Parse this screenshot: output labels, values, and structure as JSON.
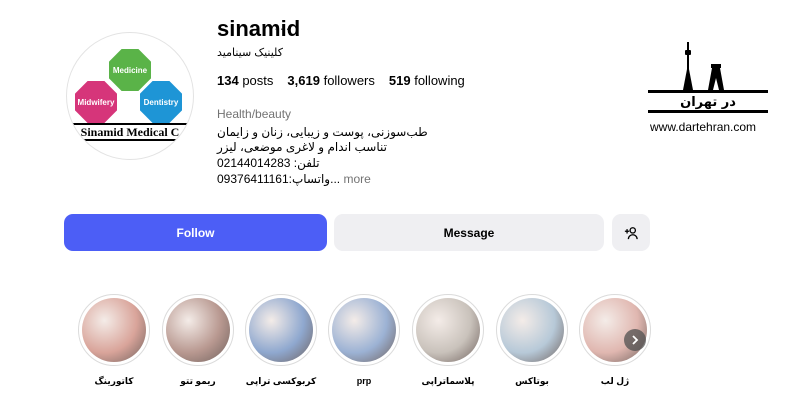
{
  "profile": {
    "username": "sinamid",
    "more_dots": "···",
    "full_name": "کلینیک سینامید",
    "category": "Health/beauty",
    "bio_lines": [
      "طب‌سوزنی، پوست و زیبایی، زنان و زایمان",
      "تناسب اندام و لاغری موضعی، لیزر",
      "تلفن: 02144014283"
    ],
    "bio_last": "09376411161:واتساپ...",
    "more_label": " more"
  },
  "stats": {
    "posts_count": "134",
    "posts_label": "posts",
    "followers_count": "3,619",
    "followers_label": "followers",
    "following_count": "519",
    "following_label": "following"
  },
  "avatar": {
    "medicine": "Medicine",
    "midwifery": "Midwifery",
    "dentistry": "Dentistry",
    "brand": "Sinamid Medical C"
  },
  "partner": {
    "logo_text": "در تهران",
    "url": "www.dartehran.com"
  },
  "actions": {
    "follow": "Follow",
    "message": "Message",
    "add_person_icon": "add-person-icon"
  },
  "highlights": [
    {
      "label": "کاتورینگ",
      "color": "#d9a49a"
    },
    {
      "label": "ریمو تتو",
      "color": "#b89890"
    },
    {
      "label": "کربوکسی تراپی",
      "color": "#8fa8cf"
    },
    {
      "label": "prp",
      "color": "#9cb2d4"
    },
    {
      "label": "پلاسماتراپی",
      "color": "#c9c2bb"
    },
    {
      "label": "بوتاکس",
      "color": "#b7c9d8"
    },
    {
      "label": "ژل لب",
      "color": "#e0b7b0"
    }
  ],
  "colors": {
    "accent": "#4c5ef6",
    "secondary_button": "#efeff2"
  }
}
